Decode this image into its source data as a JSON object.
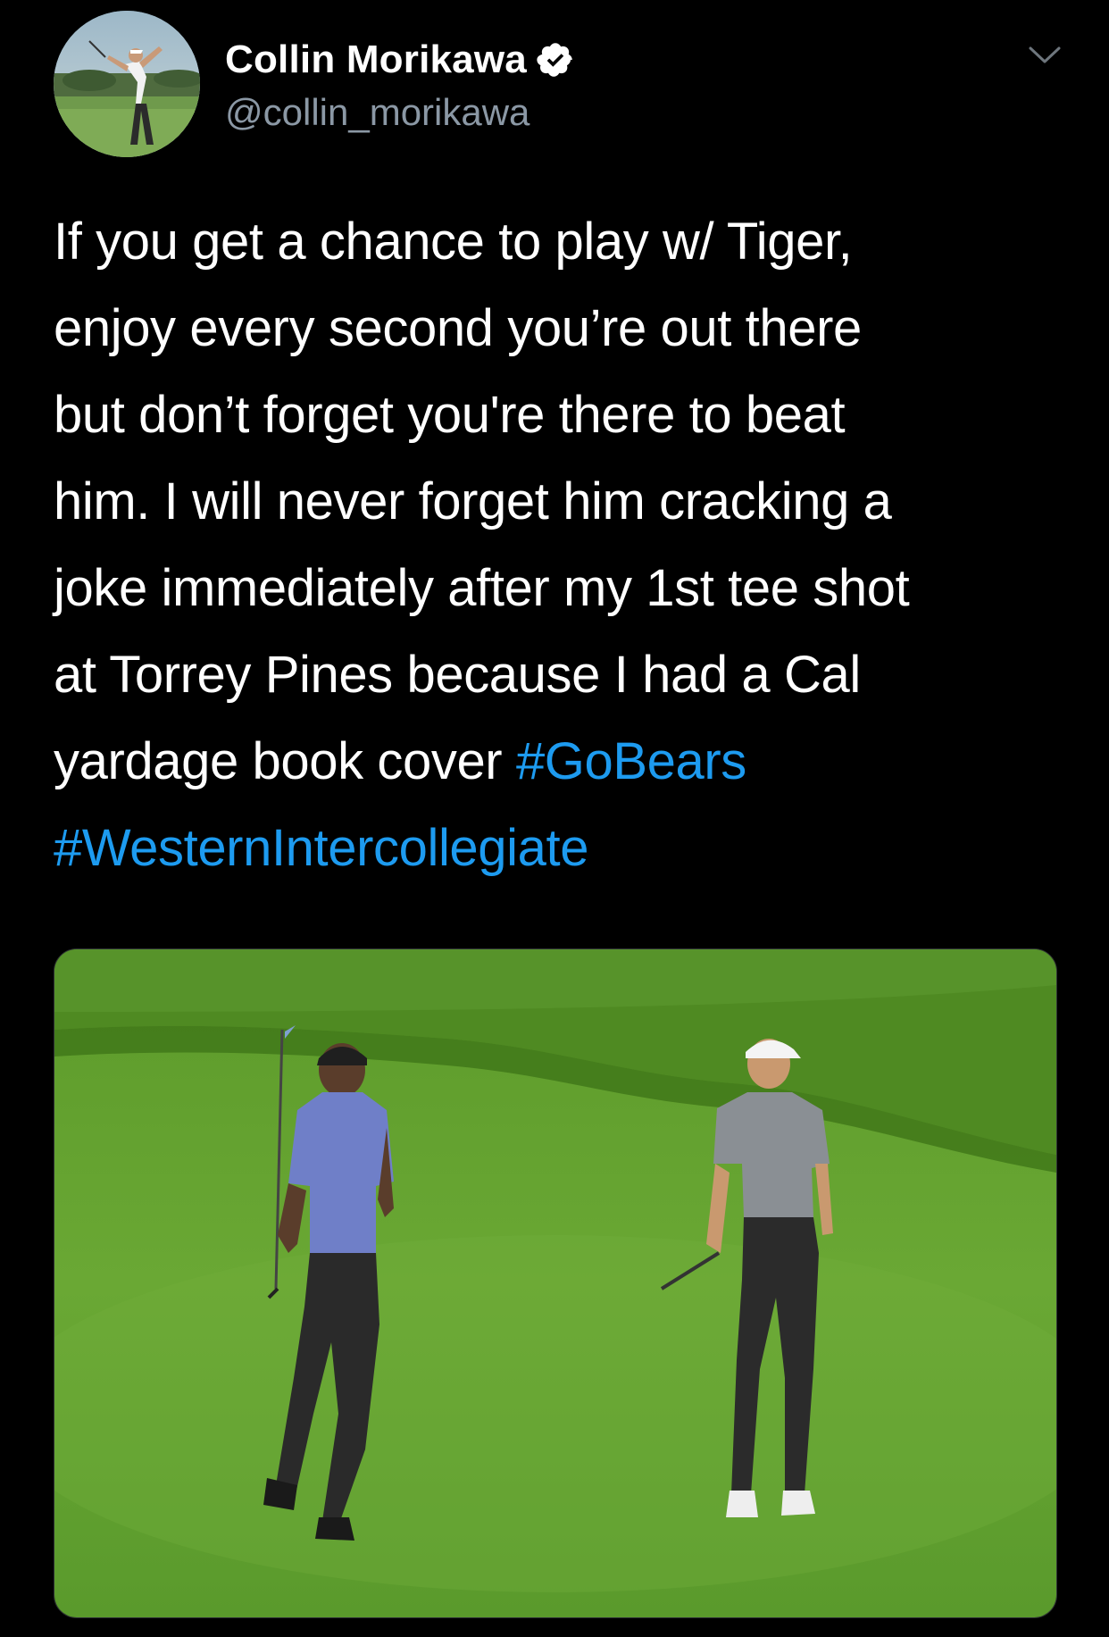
{
  "author": {
    "display_name": "Collin Morikawa",
    "handle": "@collin_morikawa",
    "verified": true,
    "avatar_icon": "golfer-swing-avatar"
  },
  "tweet": {
    "lines": [
      "If you get a chance to play w/ Tiger,",
      "enjoy every second you’re out there",
      "but don’t forget you're there to beat",
      "him. I will never forget him cracking a",
      "joke immediately after my 1st tee shot",
      "at Torrey Pines because I had a Cal",
      "yardage book cover "
    ],
    "hashtags": [
      "#GoBears",
      "#WesternIntercollegiate"
    ]
  },
  "media": {
    "icon": "golf-course-photo"
  },
  "colors": {
    "background": "#000000",
    "text": "#ffffff",
    "secondary_text": "#8b98a5",
    "link": "#1d9bf0",
    "verified_badge": "#ffffff"
  },
  "icons": {
    "verified": "verified-badge-icon",
    "more": "chevron-down-icon"
  }
}
